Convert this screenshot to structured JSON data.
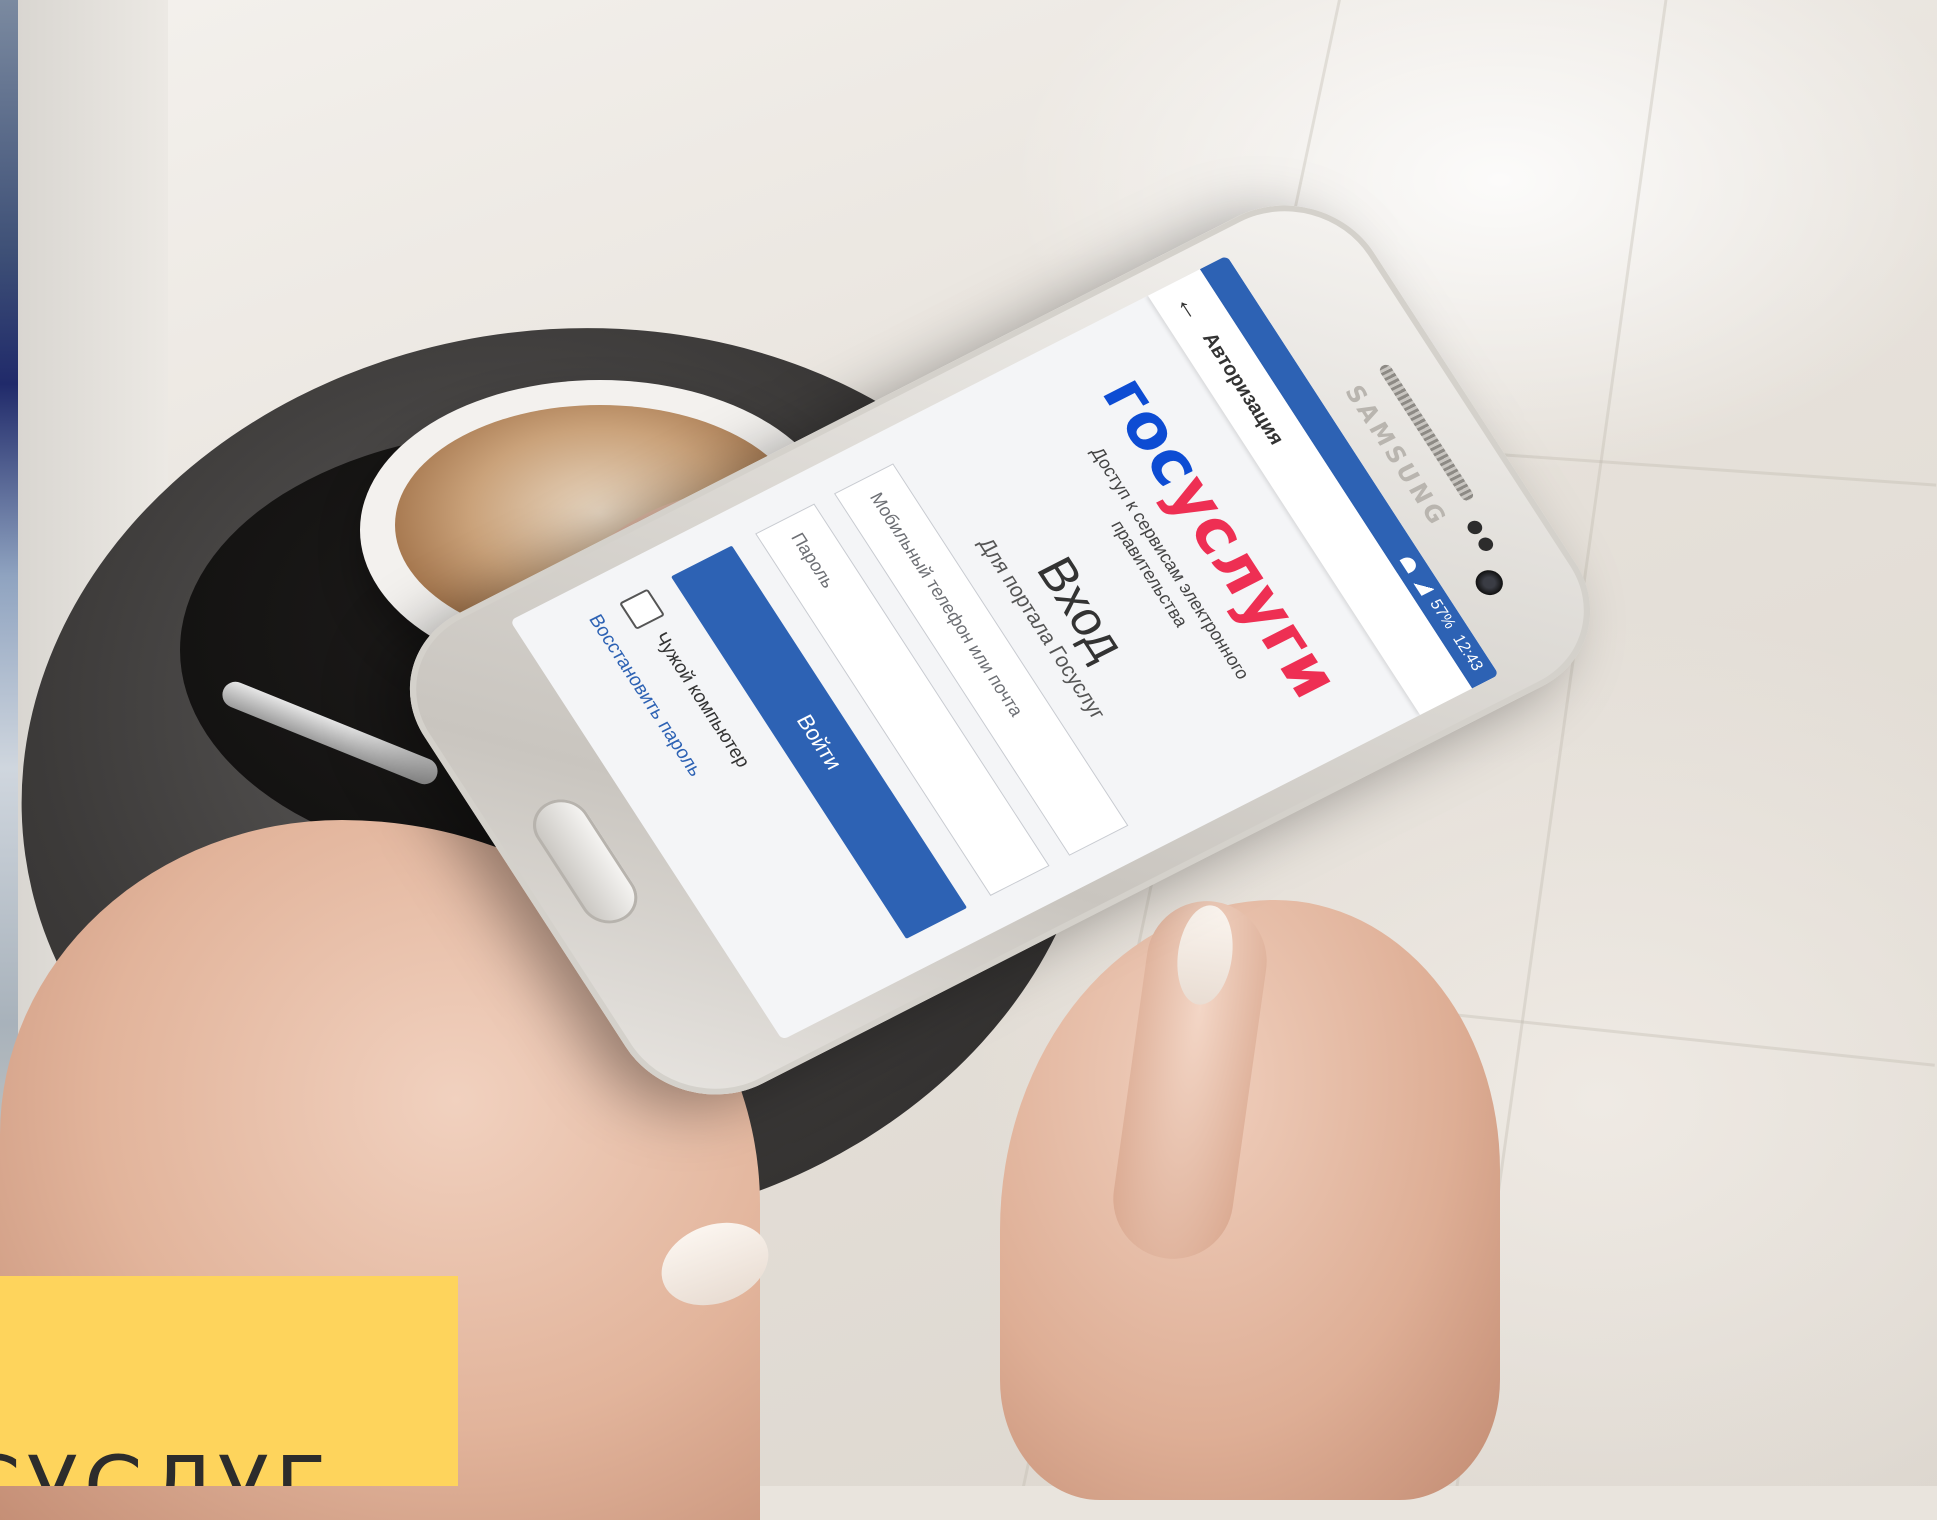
{
  "phone": {
    "brand": "SAMSUNG",
    "status_bar": {
      "battery": "57%",
      "time": "12:43"
    },
    "app_bar": {
      "title": "Авторизация"
    },
    "logo": {
      "part1": "гос",
      "part2": "услуги"
    },
    "tagline": "Доступ к сервисам электронного правительства",
    "login": {
      "title": "Вход",
      "subtitle": "Для портала Госуслуг",
      "login_placeholder": "Мобильный телефон или почта",
      "password_placeholder": "Пароль",
      "submit_label": "Войти",
      "foreign_computer_label": "Чужой компьютер",
      "recover_link": "Восстановить пароль"
    }
  },
  "caption": {
    "text": "СУСЛУГ"
  },
  "colors": {
    "brand_blue": "#2d62b4",
    "logo_blue": "#0d4cd3",
    "logo_red": "#ee2f53",
    "caption_yellow": "#fed45c"
  }
}
